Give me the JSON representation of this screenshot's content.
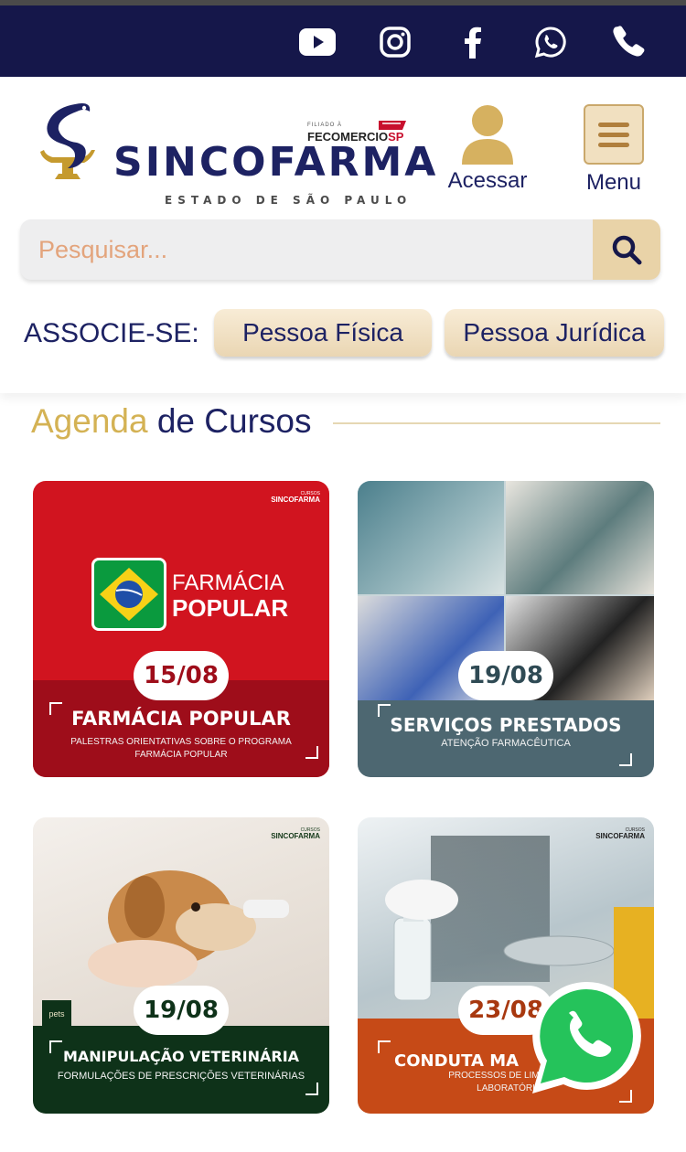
{
  "social": {
    "items": [
      {
        "name": "youtube-icon"
      },
      {
        "name": "instagram-icon"
      },
      {
        "name": "facebook-icon"
      },
      {
        "name": "whatsapp-icon"
      },
      {
        "name": "phone-icon"
      }
    ]
  },
  "brand": {
    "name": "SINCOFARMA",
    "subtitle": "ESTADO DE SÃO PAULO",
    "affiliation_small": "FILIADO À",
    "affiliation_name": "FECOMERCIO",
    "affiliation_suffix": "SP"
  },
  "header": {
    "login_label": "Acessar",
    "menu_label": "Menu"
  },
  "search": {
    "placeholder": "Pesquisar..."
  },
  "associe": {
    "label": "ASSOCIE-SE:",
    "buttons": [
      "Pessoa Física",
      "Pessoa Jurídica"
    ]
  },
  "section": {
    "title_accent": "Agenda",
    "title_rest": "de Cursos"
  },
  "courses": [
    {
      "program_logo_line1": "FARMÁCIA",
      "program_logo_line2": "POPULAR",
      "date": "15/08",
      "title": "FARMÁCIA POPULAR",
      "subtitle": "PALESTRAS ORIENTATIVAS SOBRE O PROGRAMA\nFARMÁCIA POPULAR",
      "brand_small": "CURSOS",
      "brand": "SINCOFARMA"
    },
    {
      "date": "19/08",
      "title": "SERVIÇOS PRESTADOS",
      "subtitle": "ATENÇÃO FARMACÊUTICA"
    },
    {
      "date": "19/08",
      "title": "MANIPULAÇÃO VETERINÁRIA",
      "subtitle": "FORMULAÇÕES DE PRESCRIÇÕES VETERINÁRIAS",
      "brand_small": "CURSOS",
      "brand": "SINCOFARMA",
      "badge": "pets"
    },
    {
      "date": "23/08",
      "title": "CONDUTA MA",
      "subtitle": "PROCESSOS DE LIMPEZA\nLABORATÓRI",
      "brand_small": "CURSOS",
      "brand": "SINCOFARMA"
    }
  ],
  "colors": {
    "navy": "#1d2263",
    "gold": "#d4b254",
    "social_bar": "#15174a"
  }
}
